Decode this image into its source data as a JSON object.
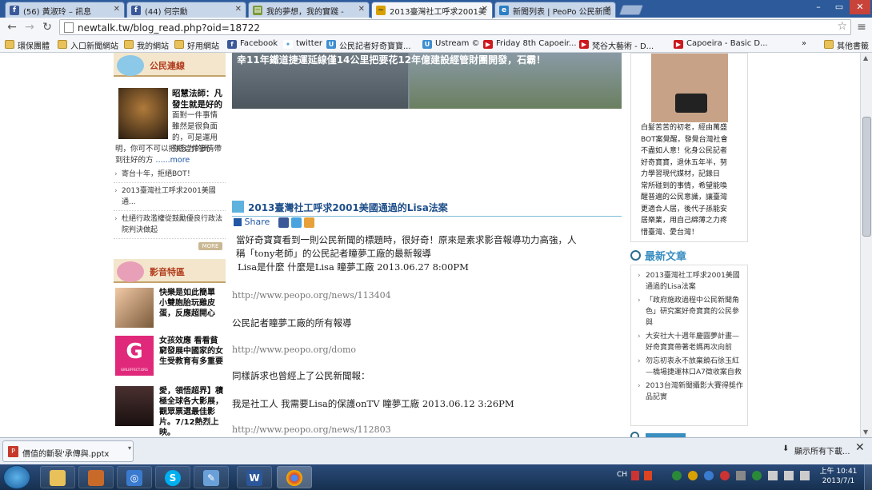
{
  "browser": {
    "tabs": [
      {
        "label": "(56) 黃淑玲 – 訊息",
        "icon": "facebook-icon"
      },
      {
        "label": "(44) 何宗勳",
        "icon": "facebook-icon"
      },
      {
        "label": "我的夢想，我的實踐 - ",
        "icon": "blog-icon"
      },
      {
        "label": "2013臺灣社工呼求2001美",
        "icon": "newtalk-icon"
      },
      {
        "label": "新聞列表 | PeoPo 公民新聞",
        "icon": "peopo-icon"
      }
    ],
    "url": "newtalk.tw/blog_read.php?oid=18722",
    "bookmarks": [
      {
        "label": "環保團體",
        "icon": "folder-icon"
      },
      {
        "label": "入口新聞網站",
        "icon": "folder-icon"
      },
      {
        "label": "我的網站",
        "icon": "folder-icon"
      },
      {
        "label": "好用網站",
        "icon": "folder-icon"
      },
      {
        "label": "Facebook",
        "icon": "facebook-icon"
      },
      {
        "label": "twitter",
        "icon": "twitter-icon"
      },
      {
        "label": "公民記者好奇寶寶...",
        "icon": "ustream-icon"
      },
      {
        "label": "Ustream ©",
        "icon": "ustream-icon"
      },
      {
        "label": "Friday 8th Capoeir...",
        "icon": "youtube-icon"
      },
      {
        "label": "梵谷大藝術 - D...",
        "icon": "youtube-icon"
      },
      {
        "label": "Capoeira - Basic D...",
        "icon": "youtube-icon"
      }
    ],
    "bookmarks_overflow": "»",
    "bookmarks_other": "其他書籤"
  },
  "sidebar_left": {
    "section1_title": "公民連線",
    "featured": {
      "title": "昭慧法師：凡發生就是好的",
      "excerpt_lines": [
        "面對一件事情",
        "雖然是很負面",
        "的，可是運用",
        "你念力的光"
      ],
      "excerpt_rest_lines": [
        "明，你可不可以把把這件事情帶",
        "到往好的方"
      ],
      "more": "......more"
    },
    "links": [
      "寄台十年，拒絕BOT！",
      "2013臺灣社工呼求2001美國通...",
      "杜絕行政濫權從鼓勵優良行政法院判決做起"
    ],
    "more_button": "MORE",
    "section2_title": "影音特區",
    "videos": [
      {
        "title": "快樂是如此簡單 小雙胞胎玩雞皮蛋，反應超開心"
      },
      {
        "title": "女孩效應 看看貧窮發展中國家的女生受教育有多重要",
        "thumb_text": "GIRLEFFECT.ORG"
      },
      {
        "title": "愛，領悟超界】積極全球各大影展，觀眾票選最佳影片。7/12熱烈上映。"
      }
    ]
  },
  "main": {
    "banner_caption": "幸11年鐵道捷運延線僅14公里把要花12年億建設經管財團開發，石霸！",
    "post_title": "2013臺灣社工呼求2001美國通過的Lisa法案",
    "share_label": "Share",
    "paragraphs": [
      "當好奇寶寶看到一則公民新聞的標題時，很好奇！原來是素求影音報導功力高強，人",
      "稱「tony老師」的公民記者瞳夢工廠的最新報導",
      "Lisa是什麼 什麼是Lisa 瞳夢工廠 2013.06.27 8:00PM"
    ],
    "url1": "http://www.peopo.org/news/113404",
    "line2": "公民記者瞳夢工廠的所有報導",
    "url2": "http://www.peopo.org/domo",
    "line3": "同樣訴求也曾經上了公民新聞報：",
    "line4": "我是社工人 我需要Lisa的保護onTV 瞳夢工廠 2013.06.12 3:26PM",
    "url3": "http://www.peopo.org/news/112803"
  },
  "sidebar_right": {
    "profile_lines": [
      "白髮苦苦的初老，經由萬盛",
      "BOT案覺醒，發覺台灣社會",
      "不盡如人意！化身公民記者",
      "好奇寶寶，退休五年半，努",
      "力學習現代媒材，記錄日",
      "常所碰到的事情，希望能喚",
      "醒普遍的公民意識，讓臺灣",
      "更適合人居，後代子孫能安",
      "居樂業，用自己綿薄之力疼",
      "惜臺灣、愛台灣！"
    ],
    "recent_title": "最新文章",
    "recent": [
      "2013臺灣社工呼求2001美國通過的Lisa法案",
      "「政府施政過程中公民新聞角色」研究案好奇寶寶的公民參與",
      "大安社大十週年慶圓夢計畫—好奇寶寶帶著老媽再次向前",
      "勿忘初衷永不放棄饒石徐玉紅—橋場捷運林口A7徵收案自救",
      "2013台灣新聞攝影大賽得獎作品記實"
    ]
  },
  "downloads": {
    "file": "價值的斷裂'承傳與.pptx",
    "show_all": "顯示所有下載...",
    "close": "✕"
  },
  "taskbar": {
    "tray_lang": "CH",
    "time": "上午 10:41",
    "date": "2013/7/1"
  },
  "colors": {
    "tab_bar": "#2c5a9a",
    "accent_blue": "#1f4f8a",
    "section_red": "#b13b1c"
  }
}
